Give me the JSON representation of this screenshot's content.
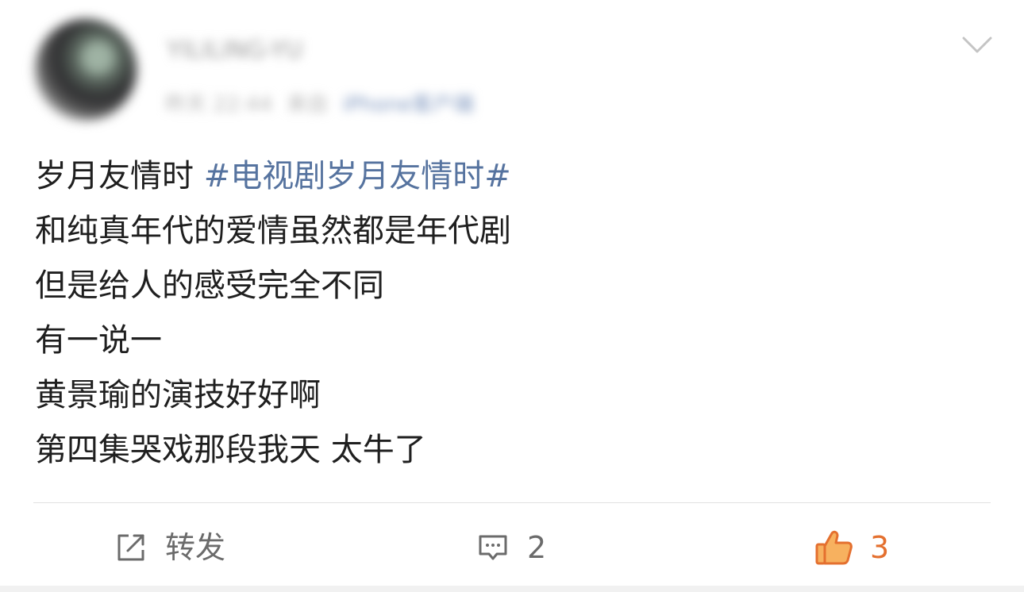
{
  "post": {
    "username": "YILILING-YU",
    "meta_time": "昨天 22:44",
    "meta_from": "来自",
    "meta_client": "iPhone客户端",
    "content_prefix": "岁月友情时 ",
    "hashtag": "#电视剧岁月友情时#",
    "lines": [
      "和纯真年代的爱情虽然都是年代剧",
      "但是给人的感受完全不同",
      "有一说一",
      "黄景瑜的演技好好啊",
      "第四集哭戏那段我天 太牛了"
    ]
  },
  "actions": {
    "repost_label": "转发",
    "comment_count": "2",
    "like_count": "3"
  },
  "colors": {
    "hashtag": "#56739f",
    "like_accent": "#e4702f",
    "action_gray": "#6b6b6b"
  },
  "icons": {
    "menu": "chevron-down-icon",
    "repost": "share-icon",
    "comment": "comment-icon",
    "like": "thumbs-up-icon"
  }
}
